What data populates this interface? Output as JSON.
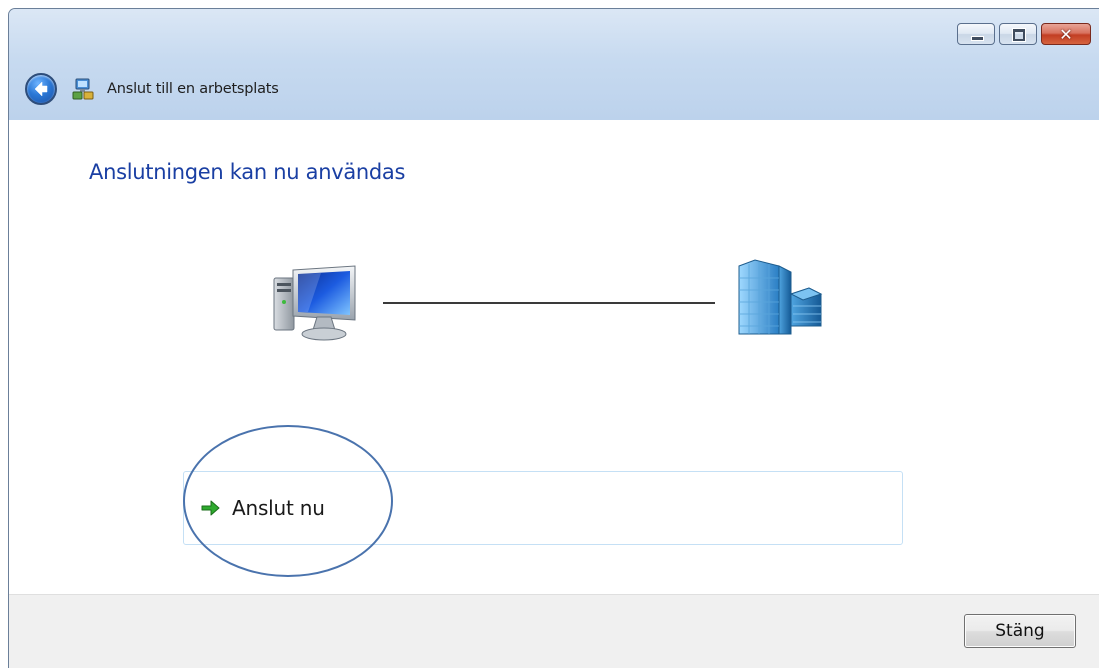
{
  "window": {
    "title": "Anslut till en arbetsplats",
    "caption_buttons": {
      "minimize_icon": "minimize-icon",
      "maximize_icon": "maximize-icon",
      "close_label": "✕"
    }
  },
  "navigation": {
    "back_icon": "back-arrow-icon",
    "wizard_icon": "network-connection-icon"
  },
  "content": {
    "heading": "Anslutningen kan nu användas",
    "illustration": {
      "left_icon": "computer-icon",
      "right_icon": "office-building-icon"
    },
    "command_link": {
      "label": "Anslut nu",
      "icon": "green-arrow-icon"
    },
    "annotation": "highlight-circle"
  },
  "footer": {
    "close_button_label": "Stäng"
  },
  "colors": {
    "heading": "#1a3fa3",
    "titlebar": "#c7daf0",
    "annotation_circle": "#4a73ad",
    "command_link_border": "#c5e0f5",
    "footer_bg": "#f0f0f0"
  }
}
